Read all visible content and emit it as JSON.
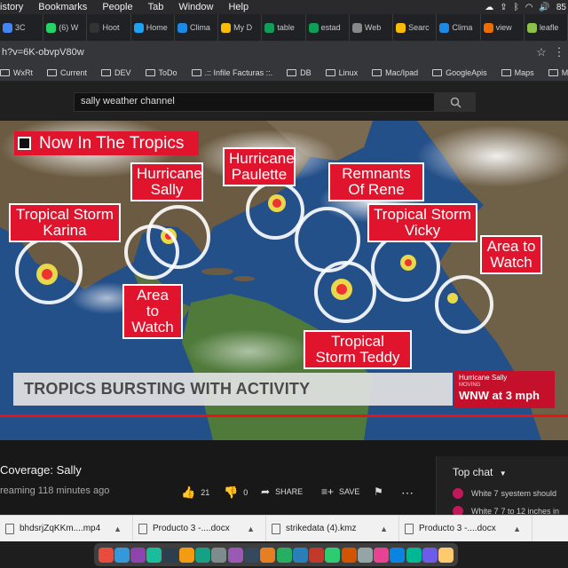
{
  "menubar": {
    "items": [
      "istory",
      "Bookmarks",
      "People",
      "Tab",
      "Window",
      "Help"
    ],
    "battery": "85"
  },
  "tabs": [
    {
      "label": "3C",
      "color": "#4285f4"
    },
    {
      "label": "(6) W",
      "color": "#25d366"
    },
    {
      "label": "Hoot",
      "color": "#333333"
    },
    {
      "label": "Home",
      "color": "#1da1f2"
    },
    {
      "label": "Clima",
      "color": "#1e88e5"
    },
    {
      "label": "My D",
      "color": "#fbbc04"
    },
    {
      "label": "table",
      "color": "#0f9d58"
    },
    {
      "label": "estad",
      "color": "#0f9d58"
    },
    {
      "label": "Web",
      "color": "#888888"
    },
    {
      "label": "Searc",
      "color": "#fbbc04"
    },
    {
      "label": "Clima",
      "color": "#1e88e5"
    },
    {
      "label": "view",
      "color": "#ef6c00"
    },
    {
      "label": "leafle",
      "color": "#8bc34a"
    }
  ],
  "url": "h?v=6K-obvpV80w",
  "bookmarks": [
    "WxRt",
    "Current",
    "DEV",
    "ToDo",
    ".:: Infile Facturas ::.",
    "DB",
    "Linux",
    "Mac/Ipad",
    "GoogleApis",
    "Maps",
    "Musi"
  ],
  "search": {
    "value": "sally weather channel"
  },
  "video": {
    "header": "Now In The Tropics",
    "labels": {
      "karina": "Tropical Storm Karina",
      "sally": "Hurricane Sally",
      "paulette": "Hurricane Paulette",
      "rene": "Remnants Of Rene",
      "vicky": "Tropical Storm Vicky",
      "watch_east": "Area to Watch",
      "watch_west": "Area to Watch",
      "teddy": "Tropical Storm Teddy"
    },
    "ticker": "TROPICS BURSTING WITH ACTIVITY",
    "hurricane_box": {
      "name": "Hurricane Sally",
      "sub": "MOVING",
      "motion": "WNW at 3 mph"
    }
  },
  "video_info": {
    "title": "Coverage: Sally",
    "meta": "reaming 118 minutes ago",
    "likes": "21",
    "dislikes": "0",
    "share": "SHARE",
    "save": "SAVE"
  },
  "chat": {
    "header": "Top chat",
    "messages": [
      {
        "author": "White 7",
        "text": "syestem should"
      },
      {
        "author": "White 7",
        "text": "7 to 12 inches in"
      }
    ]
  },
  "downloads": [
    {
      "name": "bhdsrjZqKKm....mp4"
    },
    {
      "name": "Producto 3 -....docx"
    },
    {
      "name": "strikedata (4).kmz"
    },
    {
      "name": "Producto 3 -....docx"
    }
  ]
}
